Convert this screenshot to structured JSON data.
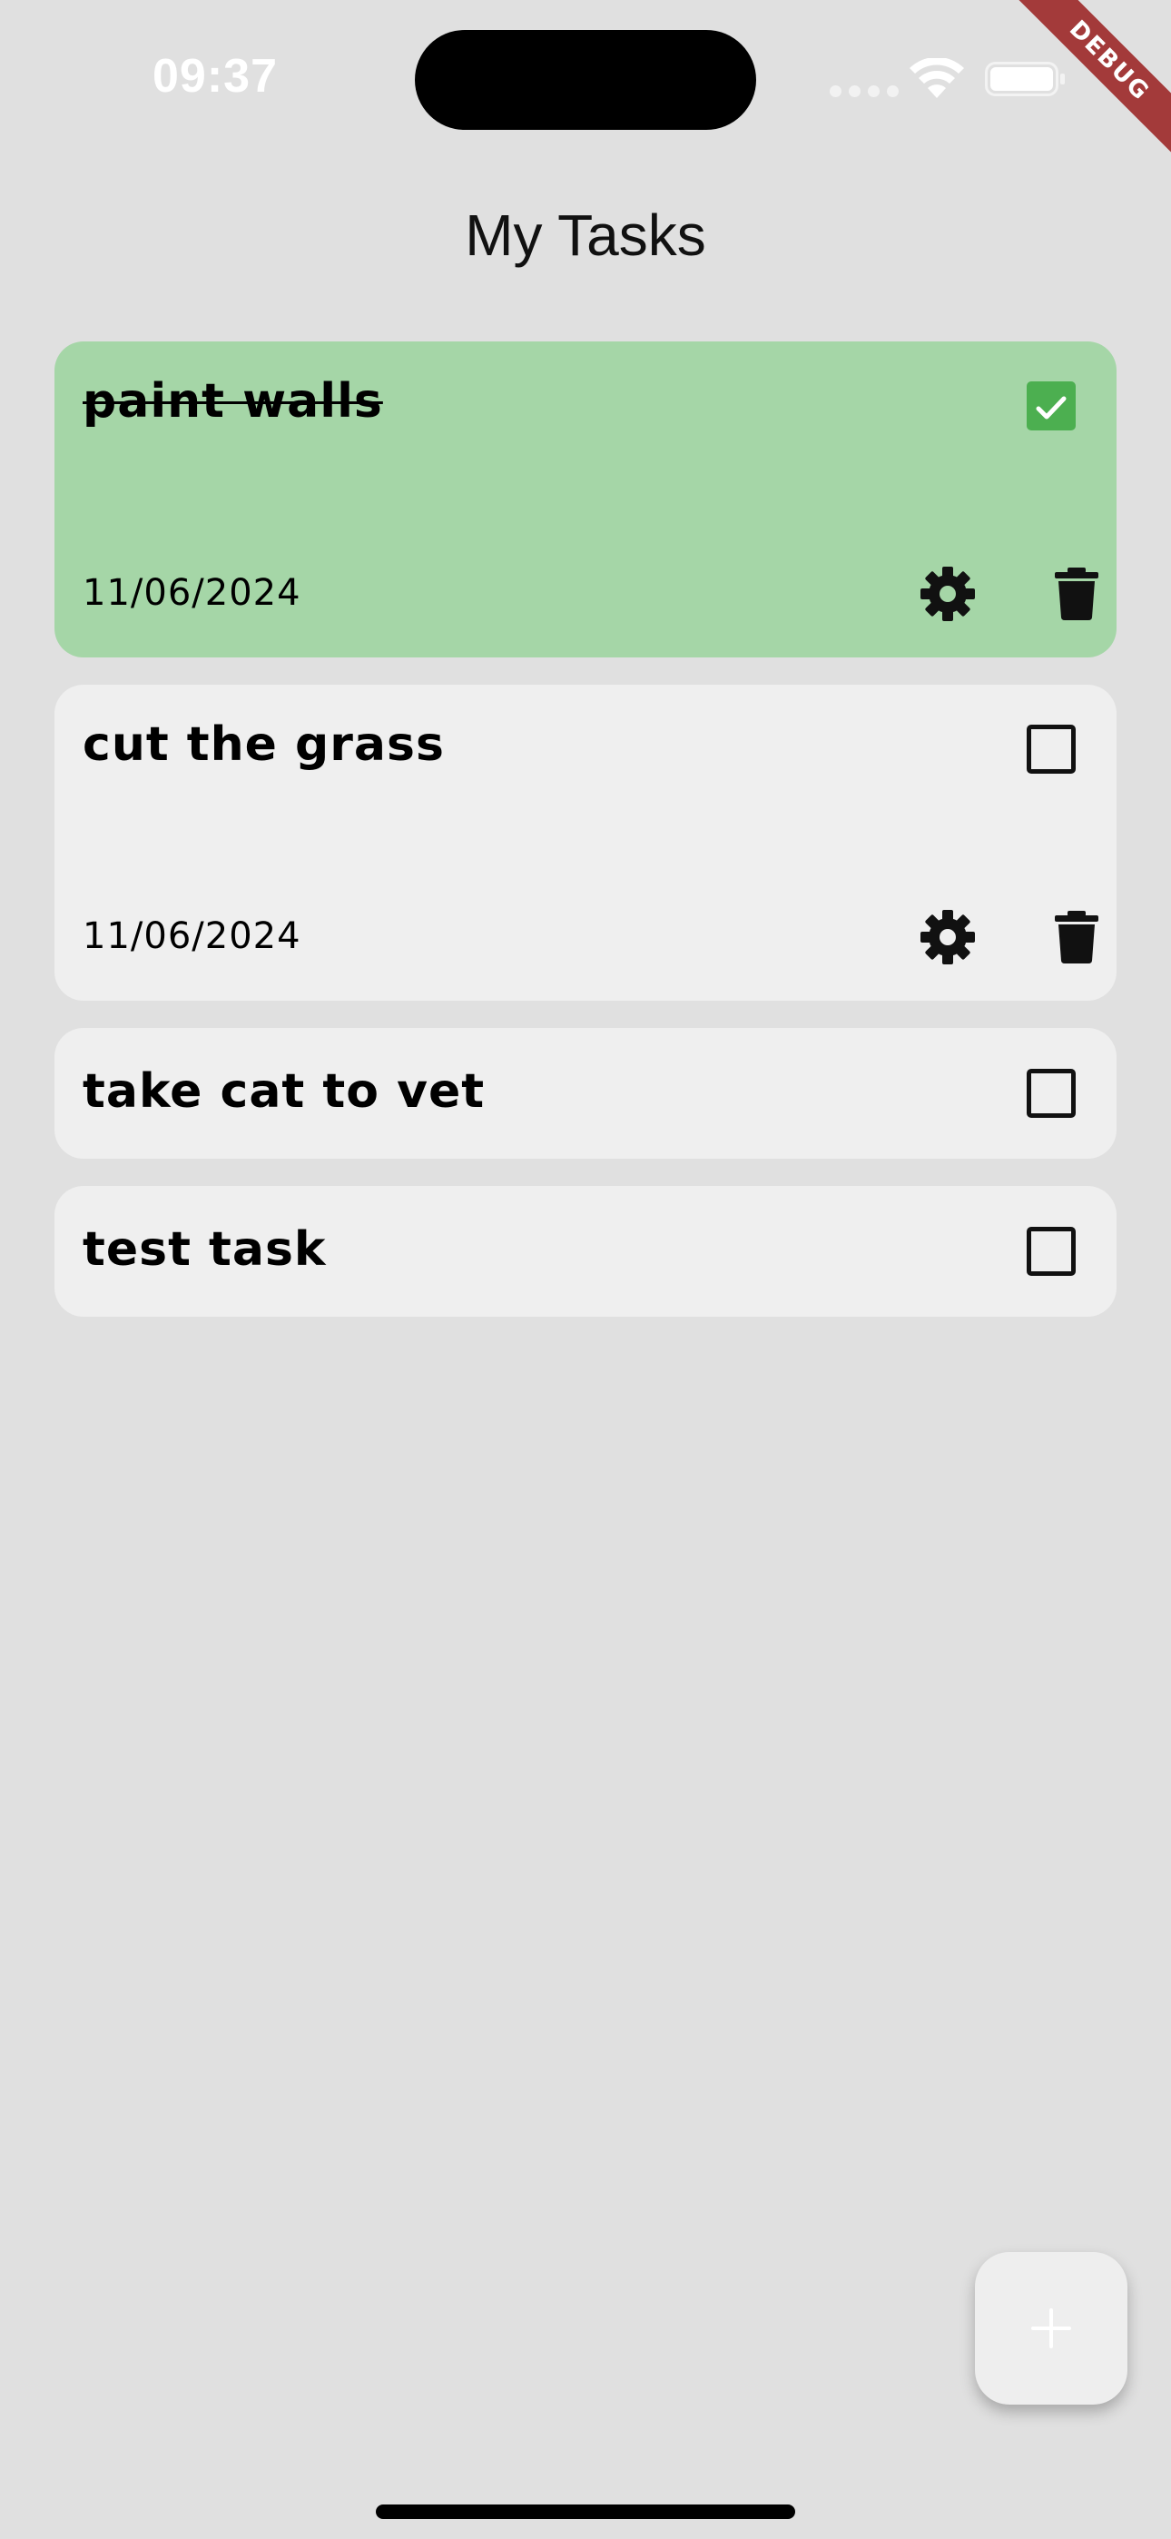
{
  "status_bar": {
    "time": "09:37",
    "wifi_icon": "wifi-icon",
    "battery_icon": "battery-icon"
  },
  "debug_banner": "DEBUG",
  "header": {
    "title": "My Tasks"
  },
  "tasks": [
    {
      "title": "paint walls",
      "completed": true,
      "expanded": true,
      "date": "11/06/2024"
    },
    {
      "title": "cut the grass",
      "completed": false,
      "expanded": true,
      "date": "11/06/2024"
    },
    {
      "title": "take cat to vet",
      "completed": false,
      "expanded": false
    },
    {
      "title": "test task",
      "completed": false,
      "expanded": false
    }
  ],
  "fab": {
    "icon": "plus-icon"
  },
  "colors": {
    "background": "#e0e0e0",
    "card": "#efefef",
    "card_completed": "#a5d6a7",
    "checkbox_checked": "#4caf50",
    "debug_ribbon": "#a33a3a"
  }
}
